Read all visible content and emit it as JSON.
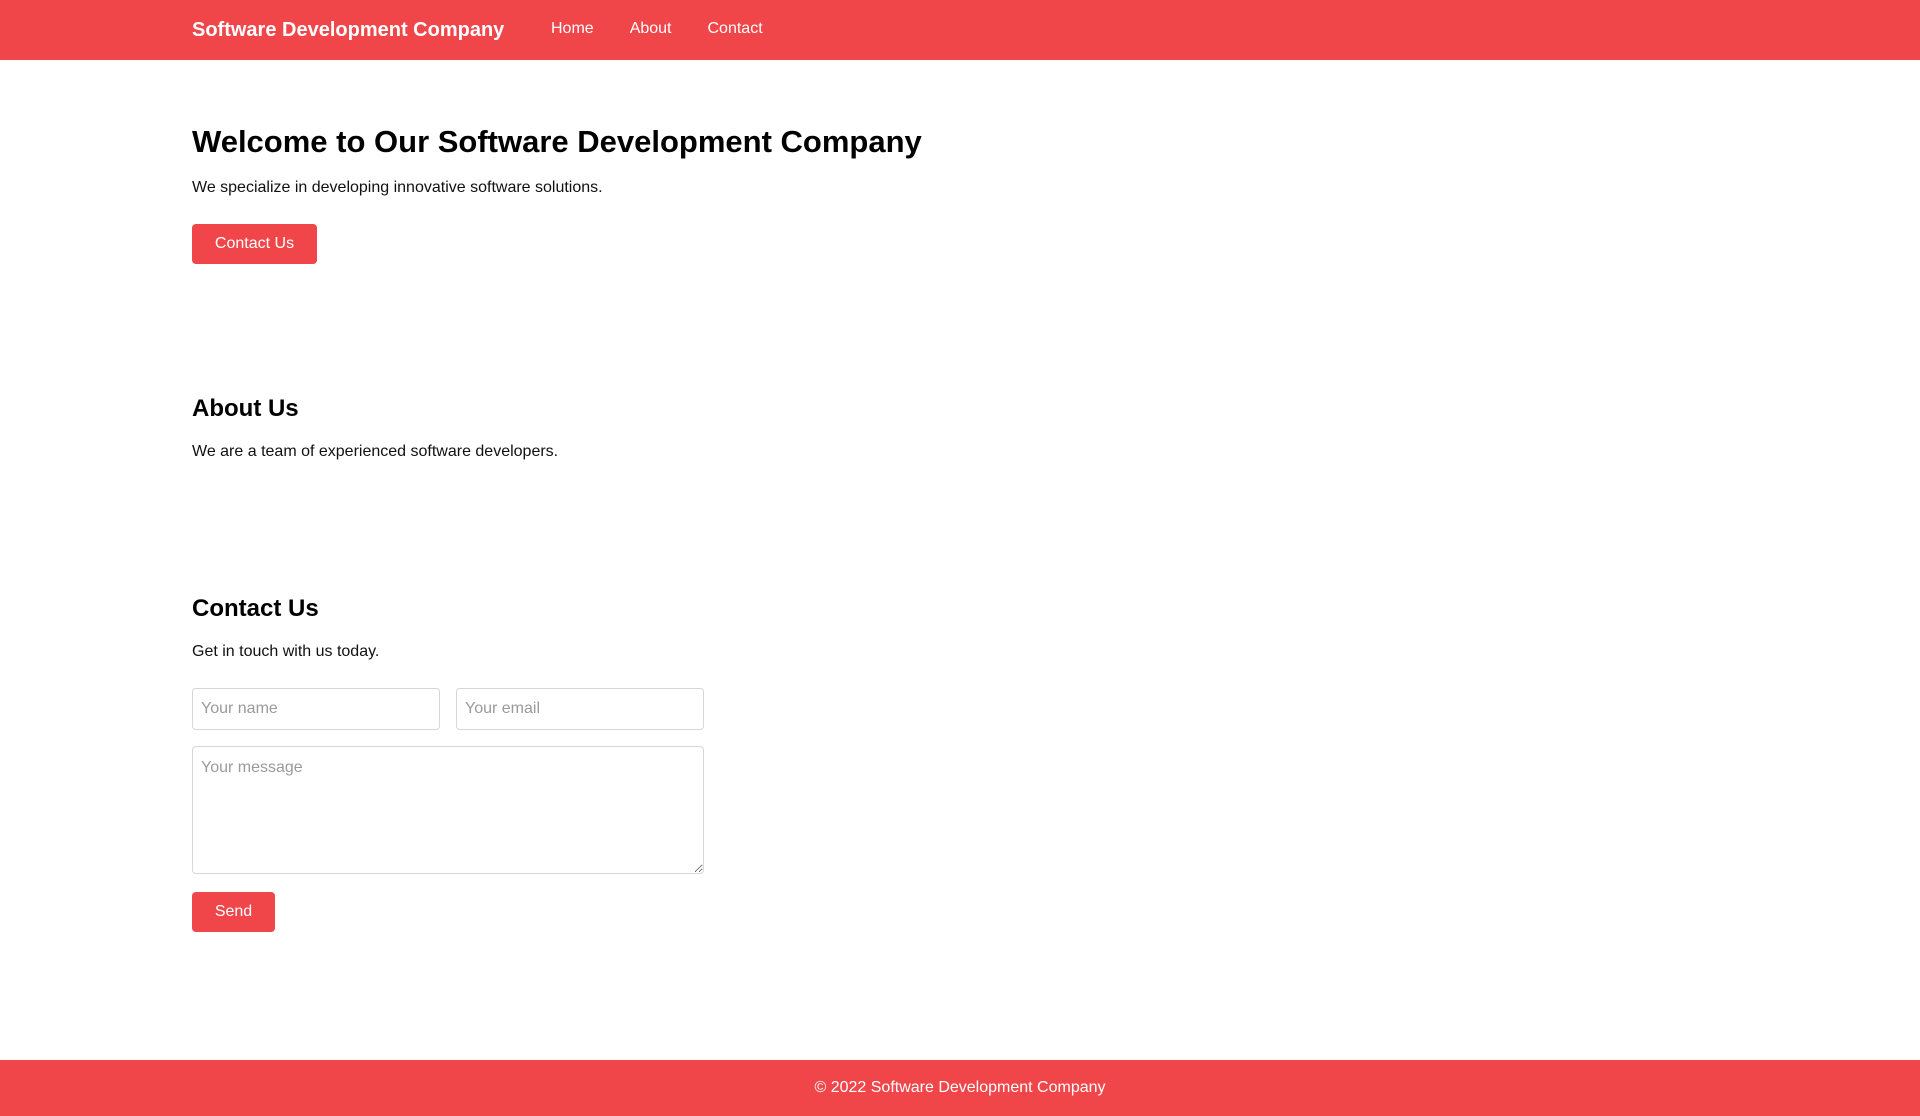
{
  "colors": {
    "accent": "#f04549",
    "text": "#111111",
    "background": "#ffffff"
  },
  "nav": {
    "brand": "Software Development Company",
    "links": [
      "Home",
      "About",
      "Contact"
    ]
  },
  "hero": {
    "title": "Welcome to Our Software Development Company",
    "text": "We specialize in developing innovative software solutions.",
    "button_label": "Contact Us"
  },
  "about": {
    "title": "About Us",
    "text": "We are a team of experienced software developers."
  },
  "contact": {
    "title": "Contact Us",
    "text": "Get in touch with us today.",
    "name_placeholder": "Your name",
    "email_placeholder": "Your email",
    "message_placeholder": "Your message",
    "send_label": "Send"
  },
  "footer": {
    "text": "© 2022 Software Development Company"
  }
}
